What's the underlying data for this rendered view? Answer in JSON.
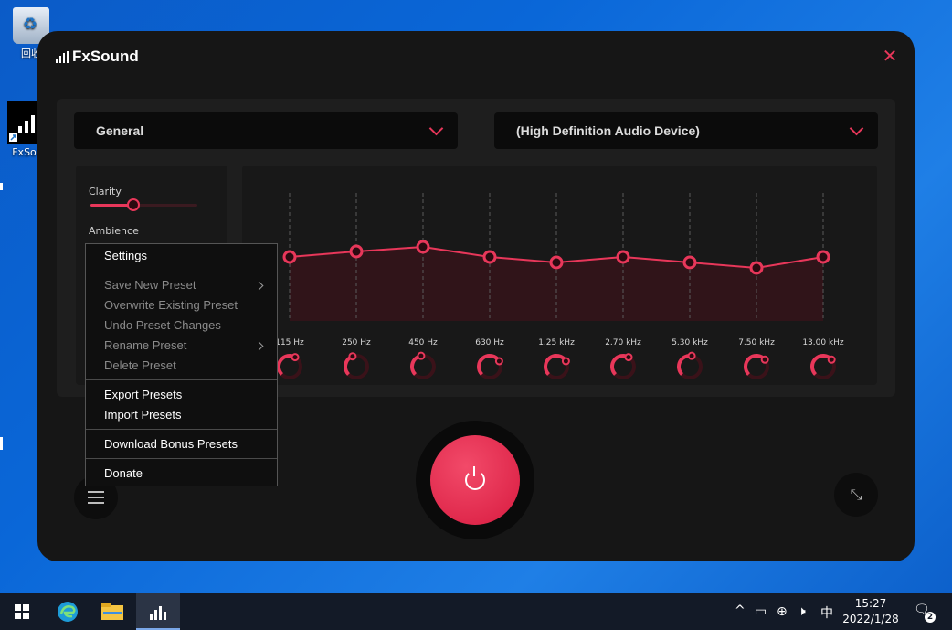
{
  "desktop": {
    "icons": [
      {
        "label": "回收"
      },
      {
        "label": "FxSou"
      }
    ]
  },
  "app": {
    "title": "FxSound",
    "close_icon": "close-icon",
    "preset": {
      "value": "General"
    },
    "device": {
      "value": "(High Definition Audio Device)"
    },
    "effects": [
      {
        "name": "Clarity",
        "level": 0.4
      },
      {
        "name": "Ambience"
      }
    ],
    "eq": {
      "bands": [
        {
          "label": "115 Hz"
        },
        {
          "label": "250 Hz"
        },
        {
          "label": "450 Hz"
        },
        {
          "label": "630 Hz"
        },
        {
          "label": "1.25 kHz"
        },
        {
          "label": "2.70 kHz"
        },
        {
          "label": "5.30 kHz"
        },
        {
          "label": "7.50 kHz"
        },
        {
          "label": "13.00 kHz"
        }
      ],
      "accent": "#e8375a"
    },
    "power_icon": "power-icon",
    "menu_icon": "hamburger-icon",
    "minimize_icon": "shrink-icon"
  },
  "context_menu": {
    "items": [
      {
        "label": "Settings",
        "enabled": true
      },
      {
        "label": "Save New Preset",
        "enabled": false,
        "submenu": true
      },
      {
        "label": "Overwrite Existing Preset",
        "enabled": false
      },
      {
        "label": "Undo Preset Changes",
        "enabled": false
      },
      {
        "label": "Rename Preset",
        "enabled": false,
        "submenu": true
      },
      {
        "label": "Delete Preset",
        "enabled": false
      },
      {
        "label": "Export Presets",
        "enabled": true
      },
      {
        "label": "Import Presets",
        "enabled": true
      },
      {
        "label": "Download Bonus Presets",
        "enabled": true
      },
      {
        "label": "Donate",
        "enabled": true
      }
    ]
  },
  "taskbar": {
    "apps": [
      "windows-start-icon",
      "edge-icon",
      "file-explorer-icon",
      "fxsound-icon"
    ],
    "tray": {
      "chevron": "^",
      "ime": "中",
      "time": "15:27",
      "date": "2022/1/28",
      "notifications": "2"
    }
  }
}
